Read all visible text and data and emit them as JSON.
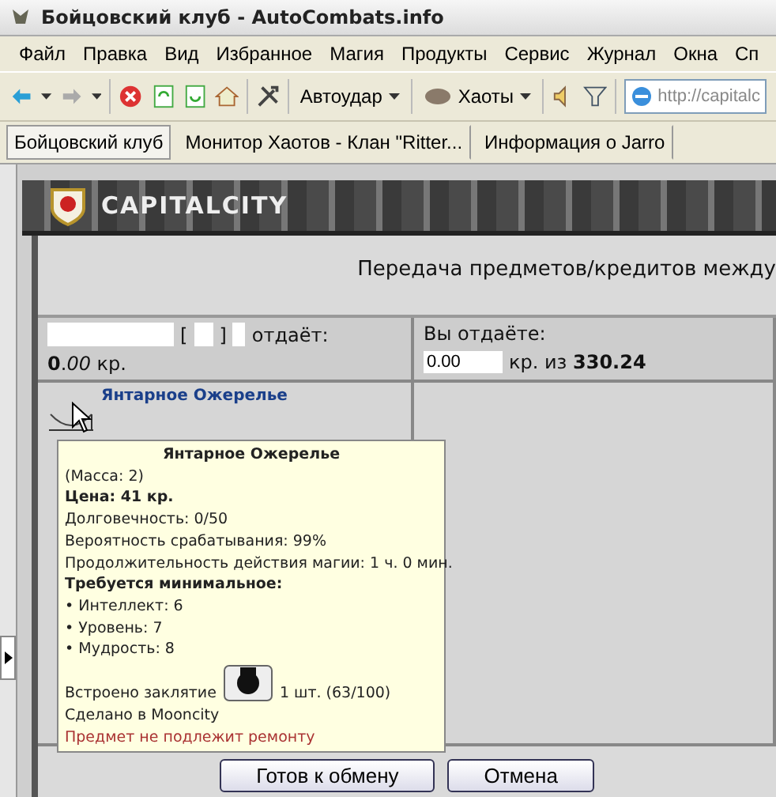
{
  "window": {
    "title": "Бойцовский клуб - AutoCombats.info"
  },
  "menu": [
    "Файл",
    "Правка",
    "Вид",
    "Избранное",
    "Магия",
    "Продукты",
    "Сервис",
    "Журнал",
    "Окна",
    "Сп"
  ],
  "toolbar": {
    "autostrike": "Автоудар",
    "chaos": "Хаоты",
    "address": "http://capitalc"
  },
  "tabs": [
    {
      "label": "Бойцовский клуб",
      "selected": true
    },
    {
      "label": "Монитор Хаотов - Клан \"Ritter...",
      "selected": false
    },
    {
      "label": "Информация о Jarro",
      "selected": false
    }
  ],
  "banner": {
    "logo": "CAPITALCITY"
  },
  "heading": "Передача предметов/кредитов между",
  "trade": {
    "left": {
      "open_bracket": "[",
      "close_bracket": "]",
      "label": "отдаёт:",
      "amount": "**0**.*00* кр.",
      "item": "Янтарное Ожерелье"
    },
    "right": {
      "label": "Вы отдаёте:",
      "input": "0.00",
      "amount": "кр. из **330.24**"
    }
  },
  "tooltip": {
    "title": "Янтарное Ожерелье",
    "lines": [
      {
        "kind": "normal",
        "text": "(Масса: 2)"
      },
      {
        "kind": "bold",
        "text": "Цена: 41 кр."
      },
      {
        "kind": "normal",
        "text": "Долговечность: 0/50"
      },
      {
        "kind": "normal",
        "text": "Вероятность срабатывания: 99%"
      },
      {
        "kind": "normal",
        "text": "Продолжительность действия магии: 1 ч. 0 мин."
      },
      {
        "kind": "bold",
        "text": "Требуется минимальное:"
      },
      {
        "kind": "bullet",
        "text": "• Интеллект: 6"
      },
      {
        "kind": "bullet",
        "text": "• Уровень: 7"
      },
      {
        "kind": "bullet",
        "text": "• Мудрость: 8"
      },
      {
        "kind": "spell",
        "text": "Встроено заклятие",
        "after": "1 шт. (63/100)"
      },
      {
        "kind": "normal",
        "text": "Сделано в Mooncity"
      },
      {
        "kind": "warning",
        "text": "Предмет не подлежит ремонту"
      }
    ]
  },
  "buttons": [
    "Готов к обмену",
    "Отмена"
  ]
}
